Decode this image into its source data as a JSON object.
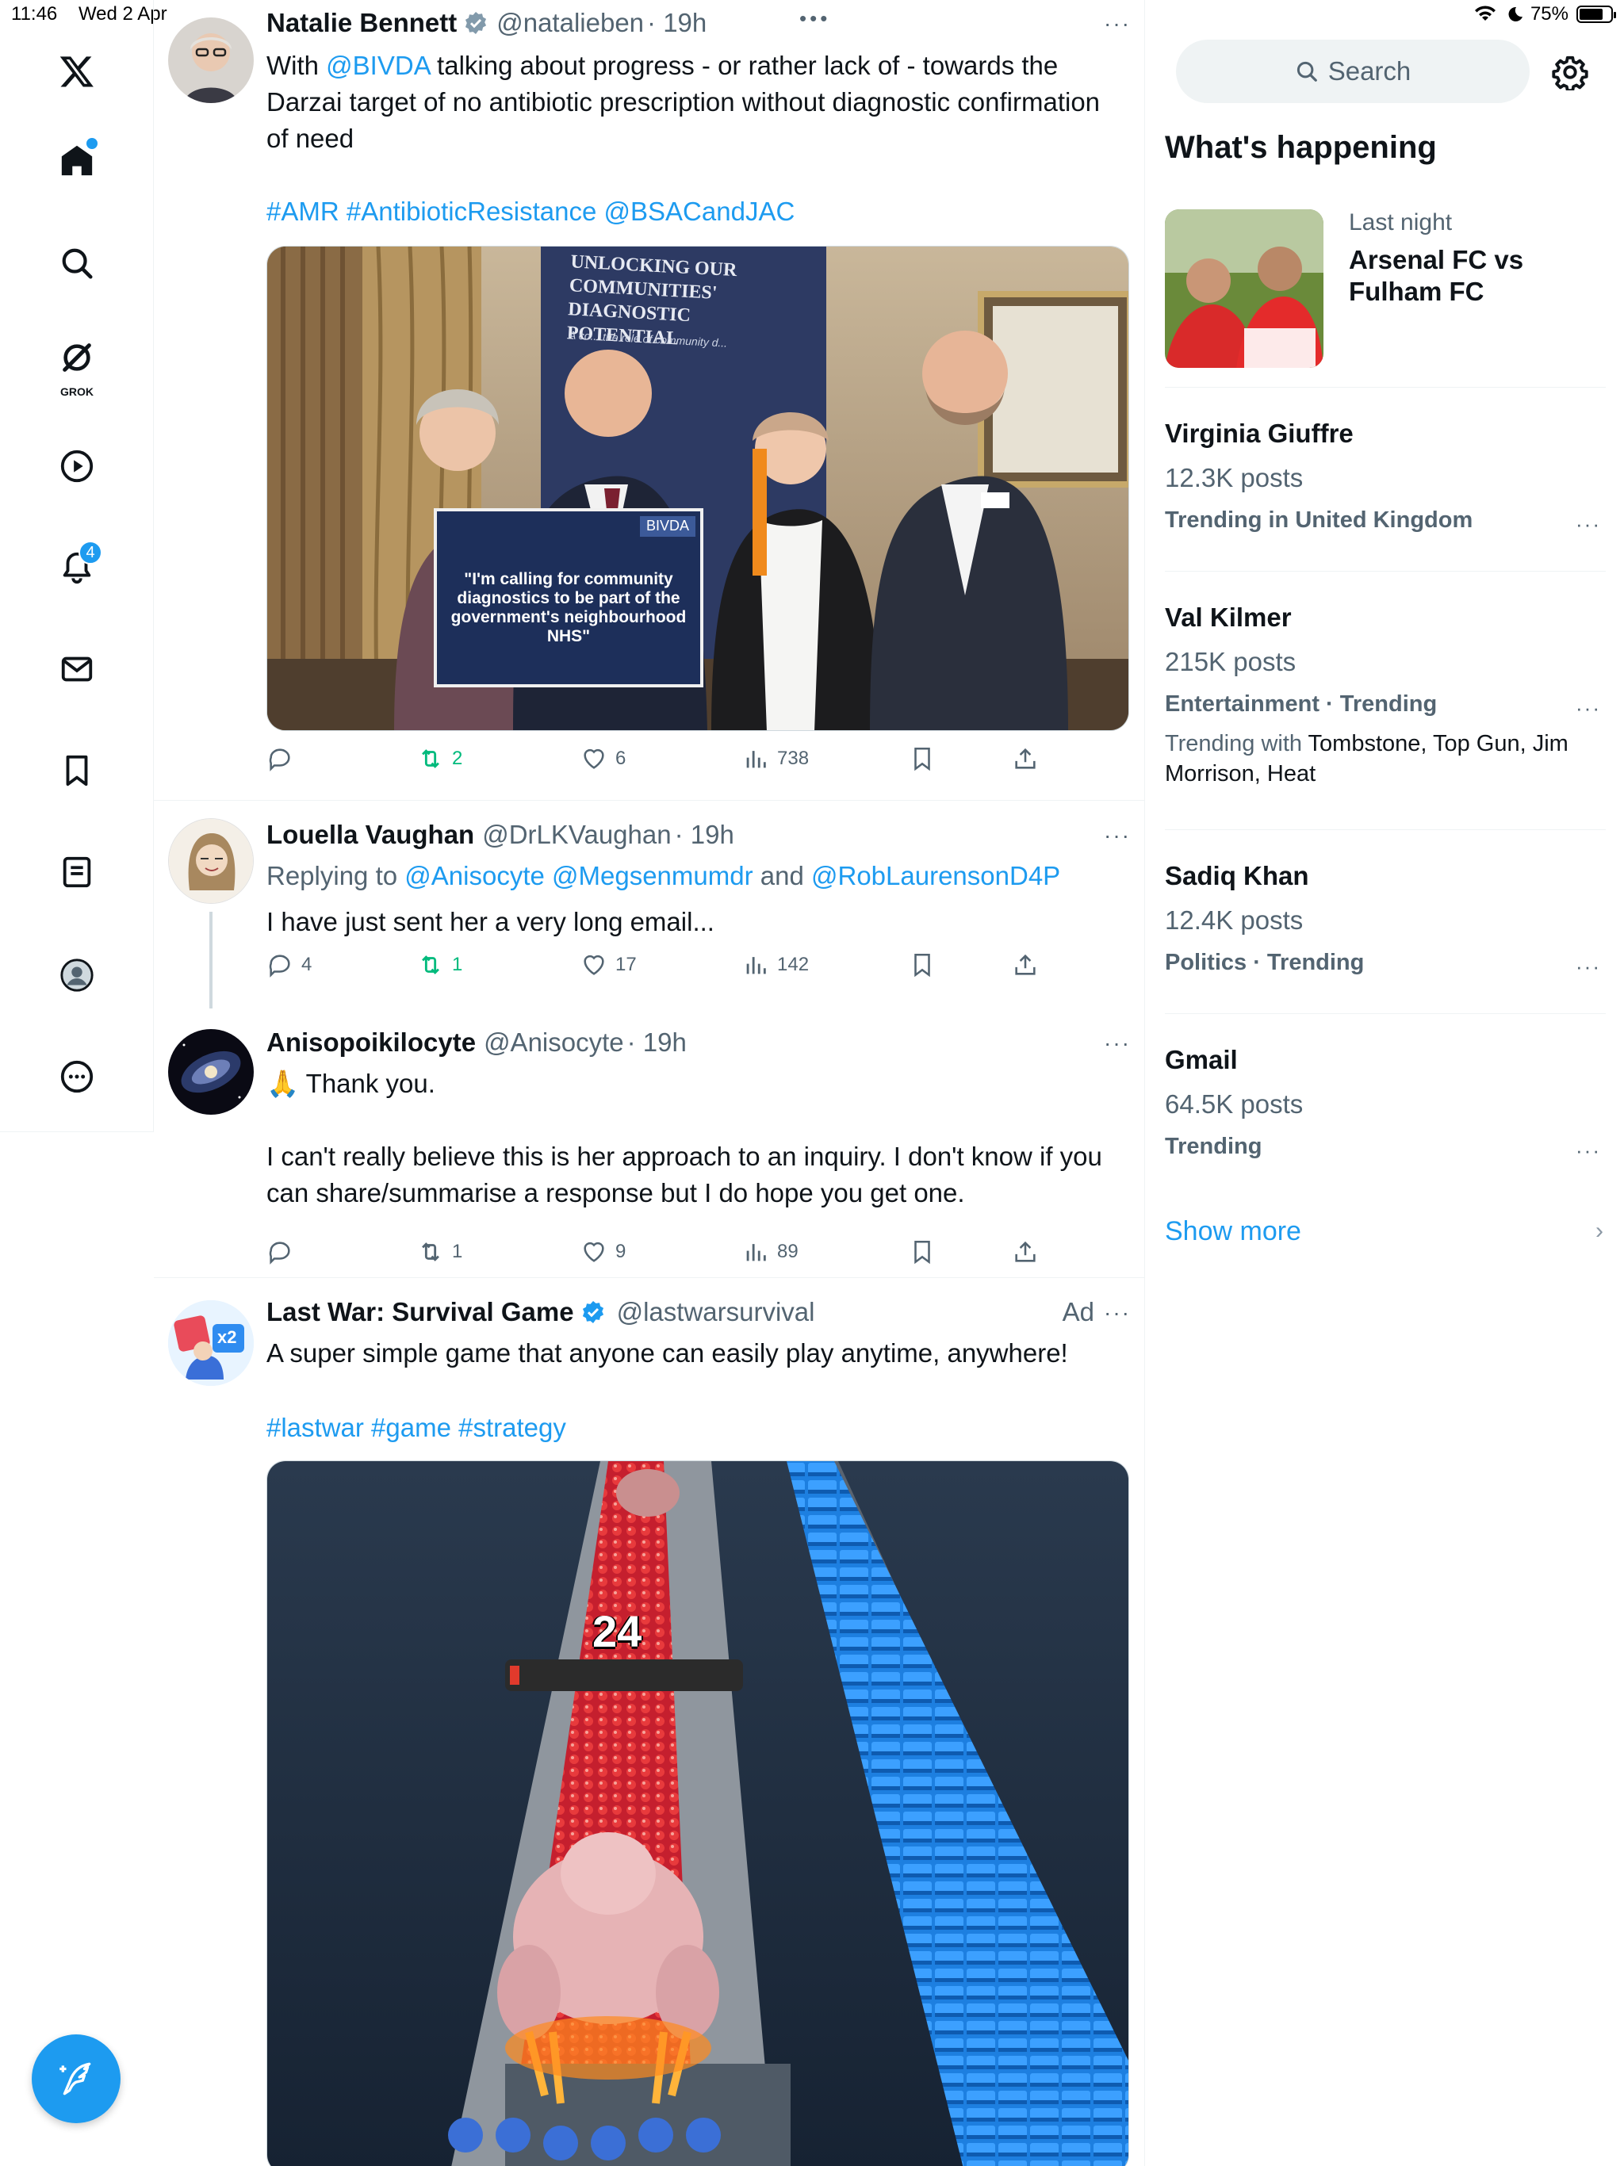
{
  "status": {
    "time": "11:46",
    "date": "Wed 2 Apr",
    "battery": "75%",
    "battery_level": 0.75,
    "multitask": "•••"
  },
  "nav": {
    "grok_label": "GROK",
    "notifications_badge": "4"
  },
  "tweets": [
    {
      "name": "Natalie Bennett",
      "handle": "@natalieben",
      "time": "· 19h",
      "more": "···",
      "text_pre": "With ",
      "mention": "@BIVDA",
      "text_post": " talking about progress - or rather lack of - towards the Darzai target of no antibiotic prescription without diagnostic confirmation of need",
      "tags": "#AMR #AntibioticResistance @BSACandJAC",
      "media": {
        "banner_title": "UNLOCKING OUR COMMUNITIES' DIAGNOSTIC POTENTIAL",
        "banner_sub": "A co... the role of community d...",
        "sign_brand": "BIVDA",
        "sign_quote": "\"I'm calling for community diagnostics to be part of the government's neighbourhood NHS\""
      },
      "actions": {
        "replies": "",
        "retweets": "2",
        "likes": "6",
        "views": "738"
      }
    },
    {
      "name": "Louella Vaughan",
      "handle": "@DrLKVaughan",
      "time": "· 19h",
      "more": "···",
      "reply_prefix": "Replying to ",
      "reply_mentions_1": "@Anisocyte @Megsenmumdr",
      "reply_and": " and ",
      "reply_mentions_2": "@RobLaurensonD4P",
      "text": "I have just sent her a very long email...",
      "actions": {
        "replies": "4",
        "retweets": "1",
        "likes": "17",
        "views": "142"
      }
    },
    {
      "name": "Anisopoikilocyte",
      "handle": "@Anisocyte",
      "time": "· 19h",
      "more": "···",
      "emoji": "🙏",
      "text_line1": " Thank you.",
      "text_para": "I can't really believe this is her approach to an inquiry. I don't know if you can share/summarise a response but I do hope you get one.",
      "actions": {
        "replies": "",
        "retweets": "1",
        "likes": "9",
        "views": "89"
      }
    },
    {
      "name": "Last War: Survival Game",
      "handle": "@lastwarsurvival",
      "ad": "Ad",
      "more": "···",
      "text": "A super simple game that anyone can easily play anytime, anywhere!",
      "tags": "#lastwar #game #strategy",
      "avatar_label": "x2",
      "media": {
        "counter": "24"
      }
    }
  ],
  "right": {
    "search_placeholder": "Search",
    "whats_happening": "What's happening",
    "featured": {
      "meta": "Last night",
      "title": "Arsenal FC vs Fulham FC"
    },
    "trends": [
      {
        "name": "Virginia Giuffre",
        "count": "12.3K posts",
        "category": "Trending in United Kingdom"
      },
      {
        "name": "Val Kilmer",
        "count": "215K posts",
        "category": "Entertainment · Trending",
        "with_label": "Trending with ",
        "with_terms": "Tombstone, Top Gun, Jim Morrison, Heat"
      },
      {
        "name": "Sadiq Khan",
        "count": "12.4K posts",
        "category": "Politics · Trending"
      },
      {
        "name": "Gmail",
        "count": "64.5K posts",
        "category": "Trending"
      }
    ],
    "trend_more": "···",
    "show_more": "Show more",
    "chevron": "›"
  },
  "colors": {
    "accent": "#1d9bf0",
    "retweet_green": "#00ba7c",
    "muted": "#536471"
  }
}
